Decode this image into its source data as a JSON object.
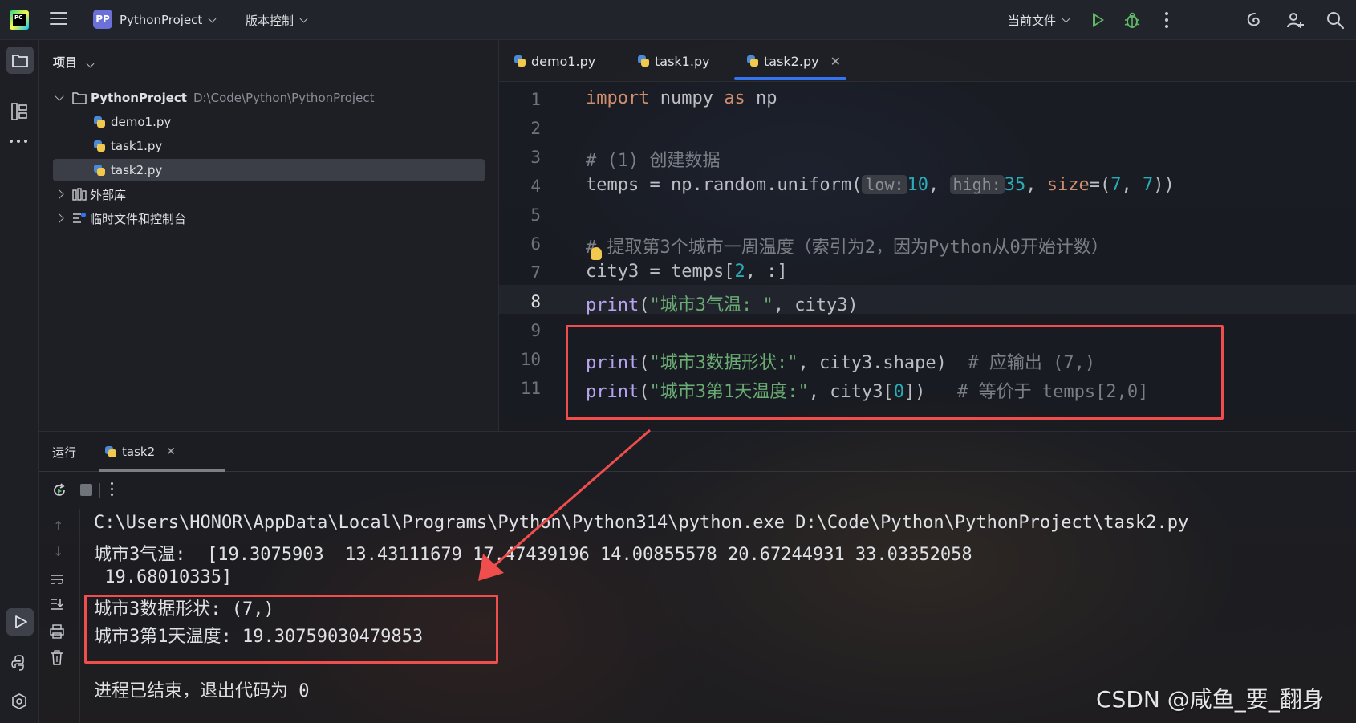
{
  "titlebar": {
    "project_badge": "PP",
    "project_name": "PythonProject",
    "vcs_label": "版本控制",
    "run_config": "当前文件"
  },
  "project_panel": {
    "title": "项目",
    "root_name": "PythonProject",
    "root_path": "D:\\Code\\Python\\PythonProject",
    "files": [
      "demo1.py",
      "task1.py",
      "task2.py"
    ],
    "external_libs": "外部库",
    "scratches": "临时文件和控制台"
  },
  "editor": {
    "tabs": [
      "demo1.py",
      "task1.py",
      "task2.py"
    ],
    "active_tab": "task2.py",
    "line_numbers": [
      "1",
      "2",
      "3",
      "4",
      "5",
      "6",
      "7",
      "8",
      "9",
      "10",
      "11"
    ],
    "current_line": "8",
    "code": {
      "l1_import": "import",
      "l1_mod": " numpy ",
      "l1_as": "as",
      "l1_alias": " np",
      "l3": "# (1) 创建数据",
      "l4_pre": "temps = np.random.uniform(",
      "l4_hint_low": "low:",
      "l4_v1": "10",
      "l4_sep1": ", ",
      "l4_hint_high": "high:",
      "l4_v2": "35",
      "l4_sep2": ", ",
      "l4_kw": "size",
      "l4_eq": "=(",
      "l4_v3": "7",
      "l4_sep3": ", ",
      "l4_v4": "7",
      "l4_end": "))",
      "l6": "# 提取第3个城市一周温度（索引为2，因为Python从0开始计数）",
      "l7_pre": "city3 = temps[",
      "l7_num": "2",
      "l7_end": ", :]",
      "l8_fn": "print",
      "l8_open": "(",
      "l8_str": "\"城市3气温: \"",
      "l8_end": ", city3)",
      "l10_fn": "print",
      "l10_open": "(",
      "l10_str": "\"城市3数据形状:\"",
      "l10_mid": ", city3.shape)  ",
      "l10_cm": "# 应输出 (7,)",
      "l11_fn": "print",
      "l11_open": "(",
      "l11_str": "\"城市3第1天温度:\"",
      "l11_mid1": ", city3[",
      "l11_num": "0",
      "l11_mid2": "])   ",
      "l11_cm": "# 等价于 temps[2,0]"
    }
  },
  "run_panel": {
    "label": "运行",
    "tab": "task2",
    "output": [
      "C:\\Users\\HONOR\\AppData\\Local\\Programs\\Python\\Python314\\python.exe D:\\Code\\Python\\PythonProject\\task2.py",
      "城市3气温:  [19.3075903  13.43111679 17.47439196 14.00855578 20.67244931 33.03352058",
      " 19.68010335]",
      "城市3数据形状: (7,)",
      "城市3第1天温度: 19.30759030479853",
      "",
      "进程已结束，退出代码为 0"
    ]
  },
  "watermark": "CSDN @咸鱼_要_翻身",
  "colors": {
    "accent": "#3574f0",
    "keyword": "#cf8e6d",
    "string": "#6aab73",
    "number": "#2aacb8",
    "function": "#b7a4f0",
    "comment": "#7a7e85",
    "annotation_red": "#f04d4d"
  }
}
